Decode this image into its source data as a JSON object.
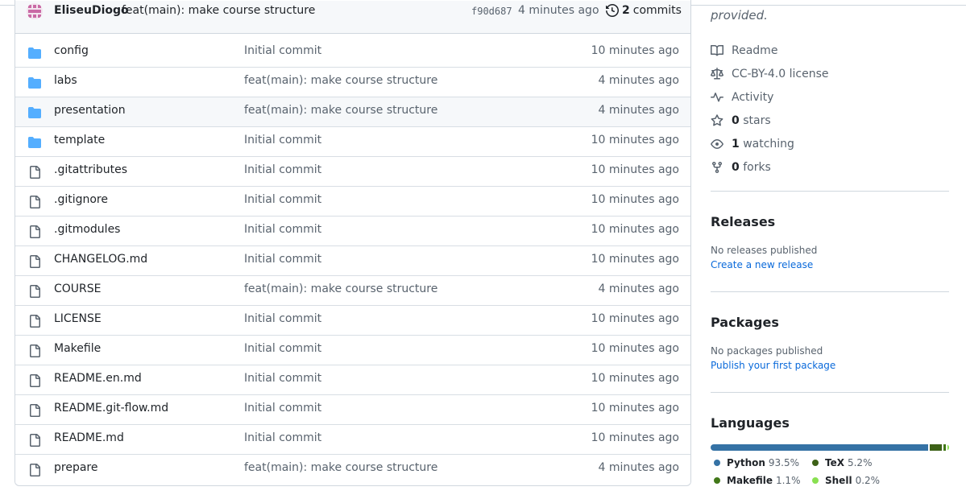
{
  "latest_commit": {
    "author": "EliseuDiogo",
    "message": "feat(main): make course structure",
    "sha": "f90d687",
    "time": "4 minutes ago",
    "commit_count": "2",
    "commit_label": "commits"
  },
  "files": [
    {
      "name": "config",
      "type": "folder",
      "message": "Initial commit",
      "time": "10 minutes ago"
    },
    {
      "name": "labs",
      "type": "folder",
      "message": "feat(main): make course structure",
      "time": "4 minutes ago"
    },
    {
      "name": "presentation",
      "type": "folder",
      "message": "feat(main): make course structure",
      "time": "4 minutes ago"
    },
    {
      "name": "template",
      "type": "folder",
      "message": "Initial commit",
      "time": "10 minutes ago"
    },
    {
      "name": ".gitattributes",
      "type": "file",
      "message": "Initial commit",
      "time": "10 minutes ago"
    },
    {
      "name": ".gitignore",
      "type": "file",
      "message": "Initial commit",
      "time": "10 minutes ago"
    },
    {
      "name": ".gitmodules",
      "type": "file",
      "message": "Initial commit",
      "time": "10 minutes ago"
    },
    {
      "name": "CHANGELOG.md",
      "type": "file",
      "message": "Initial commit",
      "time": "10 minutes ago"
    },
    {
      "name": "COURSE",
      "type": "file",
      "message": "feat(main): make course structure",
      "time": "4 minutes ago"
    },
    {
      "name": "LICENSE",
      "type": "file",
      "message": "Initial commit",
      "time": "10 minutes ago"
    },
    {
      "name": "Makefile",
      "type": "file",
      "message": "Initial commit",
      "time": "10 minutes ago"
    },
    {
      "name": "README.en.md",
      "type": "file",
      "message": "Initial commit",
      "time": "10 minutes ago"
    },
    {
      "name": "README.git-flow.md",
      "type": "file",
      "message": "Initial commit",
      "time": "10 minutes ago"
    },
    {
      "name": "README.md",
      "type": "file",
      "message": "Initial commit",
      "time": "10 minutes ago"
    },
    {
      "name": "prepare",
      "type": "file",
      "message": "feat(main): make course structure",
      "time": "4 minutes ago"
    }
  ],
  "sidebar": {
    "about_tail": "provided.",
    "readme": "Readme",
    "license": "CC-BY-4.0 license",
    "activity": "Activity",
    "stars_count": "0",
    "stars_label": "stars",
    "watching_count": "1",
    "watching_label": "watching",
    "forks_count": "0",
    "forks_label": "forks",
    "releases_title": "Releases",
    "releases_note": "No releases published",
    "releases_link": "Create a new release",
    "packages_title": "Packages",
    "packages_note": "No packages published",
    "packages_link": "Publish your first package",
    "languages_title": "Languages",
    "languages": [
      {
        "name": "Python",
        "percent": "93.5%",
        "value": 93.5,
        "color": "#3572A5"
      },
      {
        "name": "TeX",
        "percent": "5.2%",
        "value": 5.2,
        "color": "#3D6117"
      },
      {
        "name": "Makefile",
        "percent": "1.1%",
        "value": 1.1,
        "color": "#427819"
      },
      {
        "name": "Shell",
        "percent": "0.2%",
        "value": 0.2,
        "color": "#89e051"
      }
    ]
  }
}
